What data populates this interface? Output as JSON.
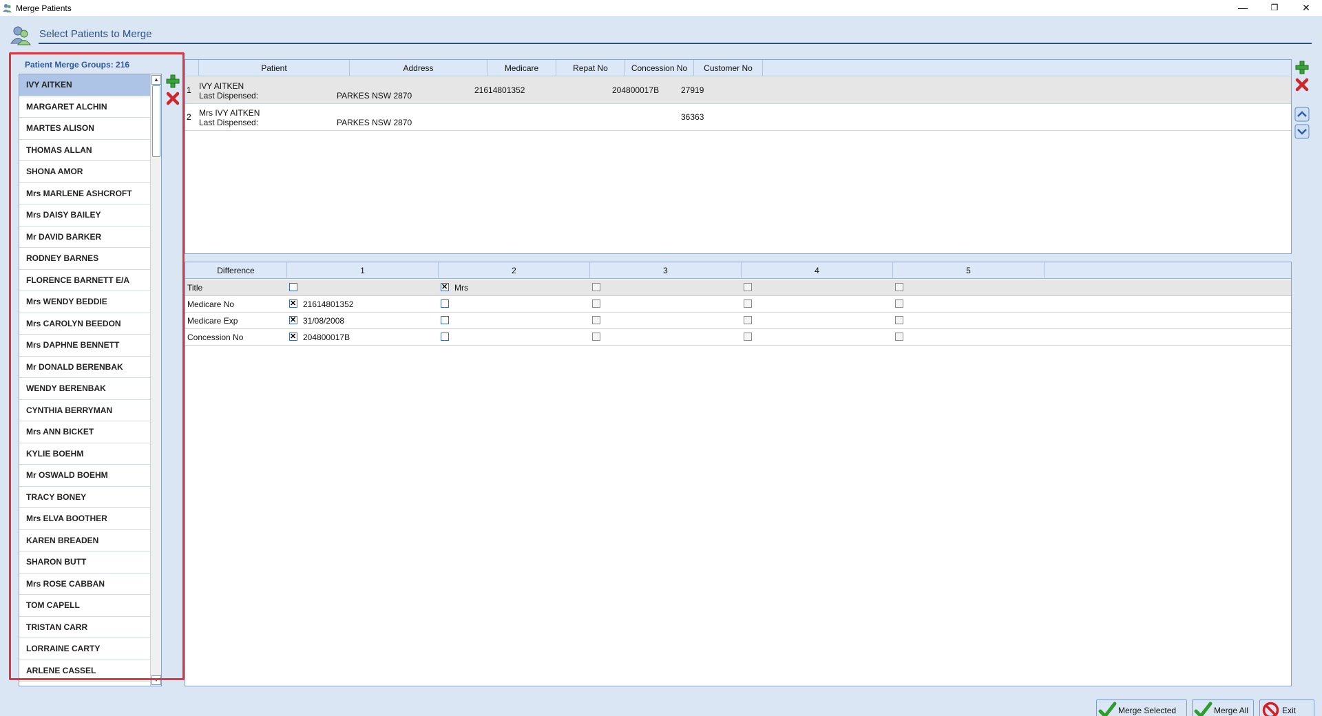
{
  "window": {
    "title": "Merge Patients",
    "minimize": "—",
    "maximize": "❐",
    "close": "✕"
  },
  "header": {
    "title": "Select Patients to Merge",
    "icon": "users-icon"
  },
  "groups": {
    "label": "Patient Merge Groups: 216",
    "items": [
      "IVY AITKEN",
      "MARGARET ALCHIN",
      "MARTES ALISON",
      "THOMAS ALLAN",
      "SHONA AMOR",
      "Mrs MARLENE ASHCROFT",
      "Mrs DAISY BAILEY",
      "Mr DAVID BARKER",
      "RODNEY BARNES",
      "FLORENCE BARNETT E/A",
      "Mrs WENDY BEDDIE",
      "Mrs CAROLYN BEEDON",
      "Mrs DAPHNE BENNETT",
      "Mr DONALD BERENBAK",
      "WENDY BERENBAK",
      "CYNTHIA BERRYMAN",
      "Mrs ANN BICKET",
      "KYLIE BOEHM",
      "Mr OSWALD BOEHM",
      "TRACY BONEY",
      "Mrs ELVA BOOTHER",
      "KAREN BREADEN",
      "SHARON BUTT",
      "Mrs ROSE CABBAN",
      "TOM CAPELL",
      "TRISTAN CARR",
      "LORRAINE CARTY",
      "ARLENE CASSEL"
    ],
    "selected": "IVY AITKEN"
  },
  "patients": {
    "columns": [
      "Patient",
      "Address",
      "Medicare",
      "Repat No",
      "Concession No",
      "Customer No"
    ],
    "rows": [
      {
        "num": "1",
        "name": "IVY AITKEN",
        "last_dispensed": "Last Dispensed:",
        "address": "PARKES NSW 2870",
        "medicare": "21614801352",
        "repat": "",
        "concession": "204800017B",
        "customer": "27919"
      },
      {
        "num": "2",
        "name": "Mrs IVY AITKEN",
        "last_dispensed": "Last Dispensed:",
        "address": "PARKES NSW 2870",
        "medicare": "",
        "repat": "",
        "concession": "",
        "customer": "36363"
      }
    ]
  },
  "differences": {
    "columns": [
      "Difference",
      "1",
      "2",
      "3",
      "4",
      "5"
    ],
    "rows": [
      {
        "label": "Title",
        "values": [
          "",
          "Mrs",
          "",
          "",
          ""
        ],
        "checked": [
          false,
          true,
          false,
          false,
          false
        ]
      },
      {
        "label": "Medicare No",
        "values": [
          "21614801352",
          "",
          "",
          "",
          ""
        ],
        "checked": [
          true,
          false,
          false,
          false,
          false
        ]
      },
      {
        "label": "Medicare Exp",
        "values": [
          "31/08/2008",
          "",
          "",
          "",
          ""
        ],
        "checked": [
          true,
          false,
          false,
          false,
          false
        ]
      },
      {
        "label": "Concession No",
        "values": [
          "204800017B",
          "",
          "",
          "",
          ""
        ],
        "checked": [
          true,
          false,
          false,
          false,
          false
        ]
      }
    ]
  },
  "buttons": {
    "merge_selected": "Merge Selected",
    "merge_all": "Merge All",
    "exit": "Exit"
  },
  "colors": {
    "accent": "#2b4f8a",
    "highlight": "#e0363d",
    "selected_row": "#aec4e6",
    "background": "#dbe6f4"
  }
}
